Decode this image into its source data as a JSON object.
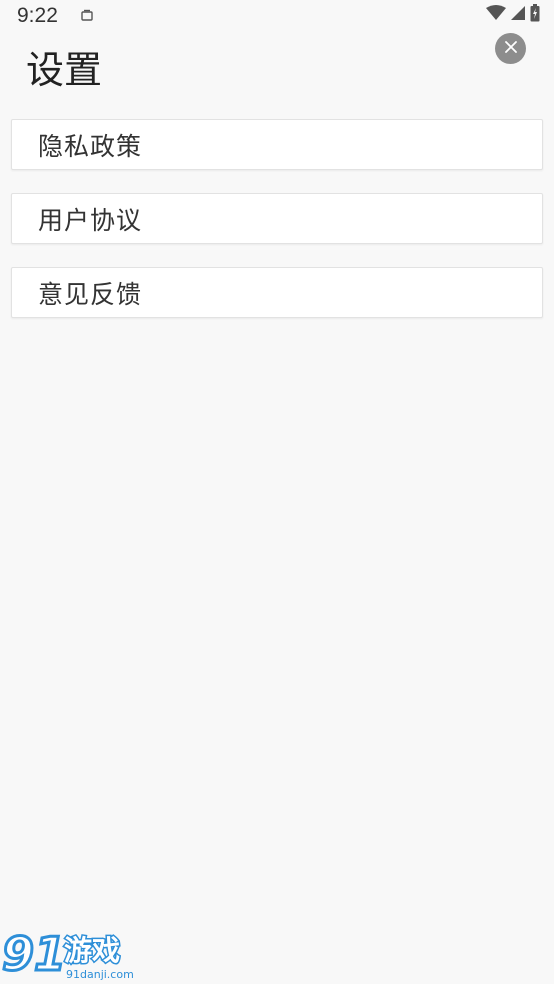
{
  "status_bar": {
    "time": "9:22"
  },
  "header": {
    "title": "设置"
  },
  "menu": {
    "items": [
      {
        "label": "隐私政策"
      },
      {
        "label": "用户协议"
      },
      {
        "label": "意见反馈"
      }
    ]
  },
  "watermark": {
    "logo_text": "91游戏",
    "url_text": "91danji.com"
  },
  "colors": {
    "background": "#f8f8f8",
    "card": "#ffffff",
    "close_button": "#8d8d8d",
    "text": "#333333"
  }
}
